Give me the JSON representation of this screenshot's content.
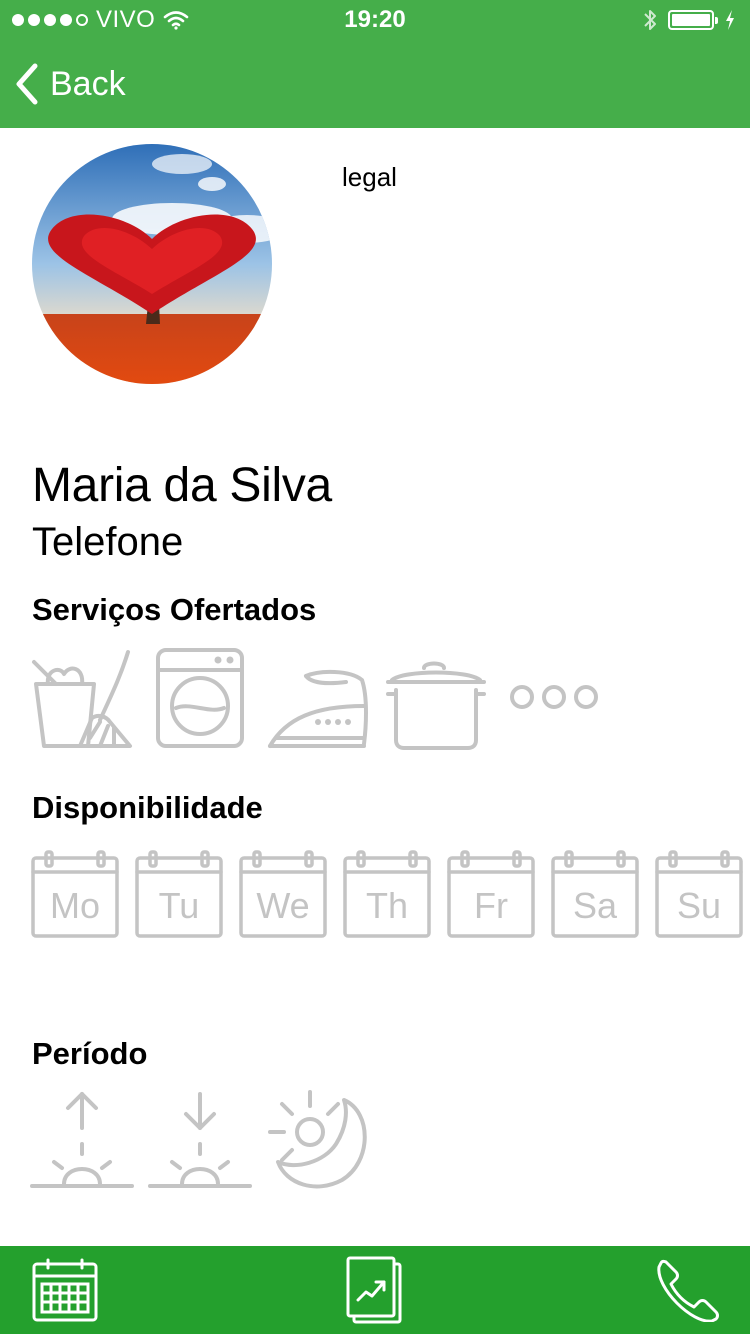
{
  "status_bar": {
    "carrier": "VIVO",
    "time": "19:20",
    "signal_bars_filled": 4,
    "signal_bars_total": 5,
    "battery_level": 1.0,
    "charging": true,
    "bluetooth": true,
    "wifi": true
  },
  "nav": {
    "back_label": "Back",
    "back_icon": "chevron-left-icon"
  },
  "profile": {
    "avatar": "heart-shaped red tree photo",
    "note": "legal",
    "name": "Maria da Silva",
    "phone_label": "Telefone"
  },
  "services": {
    "title": "Serviços Ofertados",
    "items": [
      {
        "icon": "cleaning-icon"
      },
      {
        "icon": "washing-machine-icon"
      },
      {
        "icon": "iron-icon"
      },
      {
        "icon": "cooking-pot-icon"
      },
      {
        "icon": "more-icon"
      }
    ]
  },
  "availability": {
    "title": "Disponibilidade",
    "days": [
      {
        "label": "Mo"
      },
      {
        "label": "Tu"
      },
      {
        "label": "We"
      },
      {
        "label": "Th"
      },
      {
        "label": "Fr"
      },
      {
        "label": "Sa"
      },
      {
        "label": "Su"
      }
    ]
  },
  "period": {
    "title": "Período",
    "items": [
      {
        "icon": "sunrise-icon"
      },
      {
        "icon": "sunset-icon"
      },
      {
        "icon": "day-night-icon"
      }
    ]
  },
  "tab_bar": {
    "items": [
      {
        "icon": "calendar-icon"
      },
      {
        "icon": "report-icon"
      },
      {
        "icon": "phone-icon"
      }
    ]
  },
  "colors": {
    "header": "#45ae4a",
    "tab_bar": "#24a02d",
    "icon_inactive": "#c4c4c4",
    "text": "#000000"
  }
}
